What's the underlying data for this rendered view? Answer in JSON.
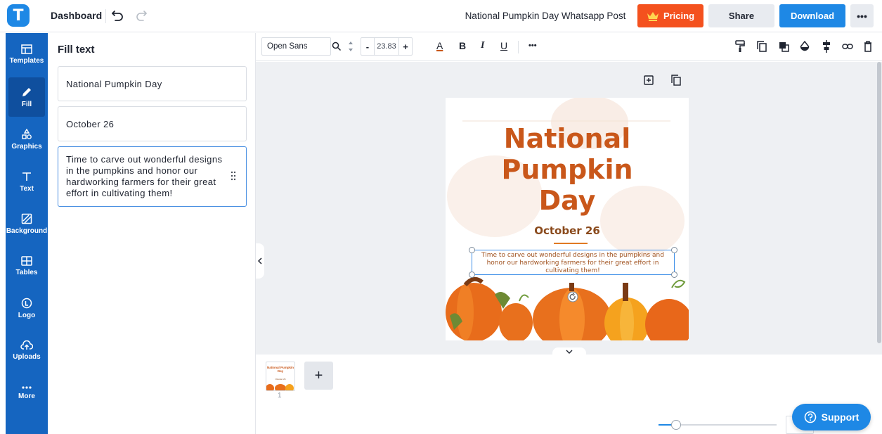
{
  "app": {
    "logo_letter": "T",
    "nav_label": "Dashboard",
    "document_title": "National Pumpkin Day Whatsapp Post"
  },
  "header": {
    "pricing_label": "Pricing",
    "share_label": "Share",
    "download_label": "Download",
    "more_label": "•••"
  },
  "sidebar": {
    "items": [
      {
        "label": "Templates",
        "icon": "templates-icon"
      },
      {
        "label": "Fill",
        "icon": "pencil-icon"
      },
      {
        "label": "Graphics",
        "icon": "shapes-icon"
      },
      {
        "label": "Text",
        "icon": "text-icon"
      },
      {
        "label": "Background",
        "icon": "background-icon"
      },
      {
        "label": "Tables",
        "icon": "table-icon"
      },
      {
        "label": "Logo",
        "icon": "logo-icon"
      },
      {
        "label": "Uploads",
        "icon": "cloud-upload-icon"
      },
      {
        "label": "More",
        "icon": "more-icon"
      }
    ],
    "active": "Fill"
  },
  "panel": {
    "title": "Fill text",
    "fields": [
      "National Pumpkin Day",
      "October 26",
      "Time to carve out wonderful designs in the pumpkins and honor our hardworking farmers for their great effort in cultivating them!"
    ]
  },
  "toolbar": {
    "font_family": "Open Sans",
    "font_size": "23.83",
    "minus_label": "-",
    "plus_label": "+",
    "color_label": "A",
    "bold_label": "B",
    "italic_label": "I",
    "underline_label": "U",
    "more_label": "•••"
  },
  "canvas": {
    "title_lines": [
      "National",
      "Pumpkin",
      "Day"
    ],
    "date": "October 26",
    "body": "Time to carve out wonderful designs in the pumpkins and honor our hardworking farmers for their great effort in cultivating them!",
    "thumbnail_title": "National Pumpkin Day",
    "thumbnail_subtitle": "October 26"
  },
  "pages": {
    "current_page_number": "1",
    "add_label": "+"
  },
  "support": {
    "label": "Support"
  },
  "colors": {
    "primary": "#1e88e5",
    "pricing": "#f4511e",
    "rail": "#1565c0",
    "title_orange": "#c9571a"
  }
}
